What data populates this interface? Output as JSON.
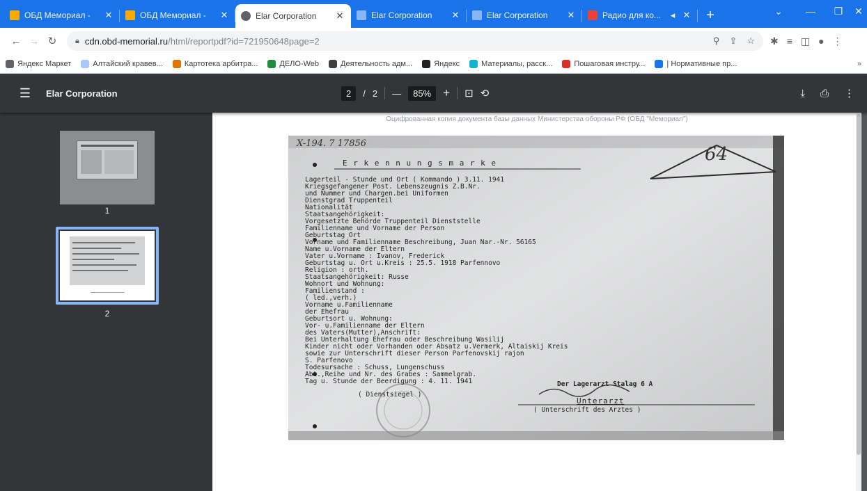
{
  "tabs": [
    {
      "title": "ОБД Мемориал -",
      "favicon_color": "#f9ab00"
    },
    {
      "title": "ОБД Мемориал -",
      "favicon_color": "#f9ab00"
    },
    {
      "title": "Elar Corporation",
      "favicon_color": "#5f6368",
      "active": true
    },
    {
      "title": "Elar Corporation",
      "favicon_color": "#8ab4f8"
    },
    {
      "title": "Elar Corporation",
      "favicon_color": "#8ab4f8"
    },
    {
      "title": "Радио для ко...",
      "favicon_color": "#ea4335"
    }
  ],
  "omnibox": {
    "host": "cdn.obd-memorial.ru",
    "path": "/html/reportpdf?id=721950648page=2"
  },
  "bookmarks": [
    {
      "label": "Яндекс Маркет",
      "color": "#5f6368"
    },
    {
      "label": "Алтайский кравев...",
      "color": "#a8c7fa"
    },
    {
      "label": "Картотека арбитра...",
      "color": "#e37400"
    },
    {
      "label": "ДЕЛО-Web",
      "color": "#1e8e3e"
    },
    {
      "label": "Деятельность адм...",
      "color": "#3c4043"
    },
    {
      "label": "Яндекс",
      "color": "#202124"
    },
    {
      "label": "Материалы, расск...",
      "color": "#12b5cb"
    },
    {
      "label": "Пошаговая инстру...",
      "color": "#d93025"
    },
    {
      "label": "| Нормативные пр...",
      "color": "#1a73e8"
    }
  ],
  "pdf": {
    "title": "Elar Corporation",
    "page_current": "2",
    "page_separator": "/",
    "page_total": "2",
    "zoom": "85%",
    "zoom_out": "—",
    "zoom_in": "+"
  },
  "thumbnails": [
    {
      "label": "1"
    },
    {
      "label": "2",
      "selected": true
    }
  ],
  "document": {
    "caption": "Оцифрованная копия документа базы данных Министерства обороны РФ (ОБД \"Мемориал\")",
    "stamp_number": "64",
    "header_code": "X-194. 7 17856",
    "heading": "E r k e n n u n g s m a r k e",
    "lines": [
      "Lagerteil - Stunde und Ort ( Kommando )    3.11. 1941",
      "Kriegsgefangener Post. Lebenszeugnis Z.B.Nr.",
      "und Nummer und Chargen.bei Uniformen",
      "Dienstgrad Truppenteil",
      "Nationalität",
      "Staatsangehörigkeit:",
      "Vorgesetzte Behörde Truppenteil      Dienststelle",
      "Familienname und Vorname der Person",
      "Geburtstag Ort",
      "Vorname und Familienname   Beschreibung, Juan Nar.-Nr. 56165",
      "Name u.Vorname der Eltern",
      "Vater u.Vorname  :  Ivanov, Frederick",
      "Geburtstag u. Ort u.Kreis   :  25.5. 1918 Parfennovo",
      "Religion  :  orth.",
      "Staatsangehörigkeit:  Russe",
      "Wohnort und Wohnung:",
      "Familienstand :",
      "  ( led.,verh.)",
      "Vorname u.Familienname",
      "         der Ehefrau",
      "Geburtsort u. Wohnung:",
      "Vor- u.Familienname der Eltern",
      "des Vaters(Mutter),Anschrift:",
      "Bei Unterhaltung Ehefrau oder    Beschreibung Wasilij",
      "Kinder nicht oder Vorhanden oder Absatz  u.Vermerk, Altaiskij Kreis",
      "sowie zur Unterschrift dieser Person   Parfenovskij rajon",
      "                                          S. Parfenovo",
      "Todesursache  :  Schuss, Lungenschuss",
      "Abt.,Reihe und Nr. des Grabes :  Sammelgrab.",
      "Tag u. Stunde der Beerdigung :  4. 11. 1941"
    ],
    "signature_block": {
      "unit": "Der Lagerarzt Stalag 6 A",
      "sig": "Unterarzt",
      "caption": "( Unterschrift des Arztes )"
    },
    "stamp_caption": "( Dienstsiegel )"
  }
}
